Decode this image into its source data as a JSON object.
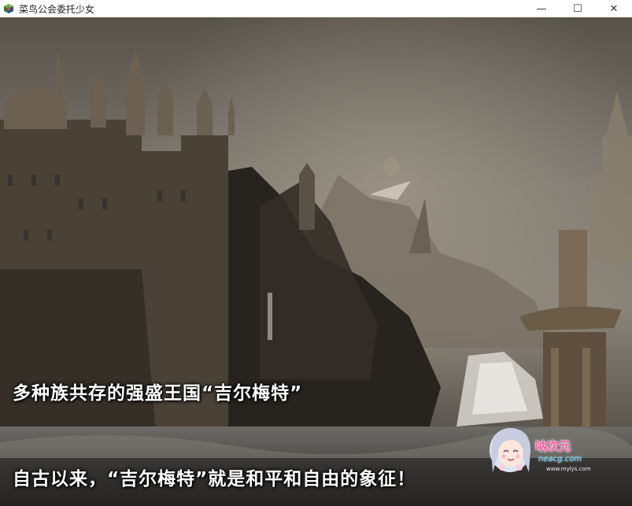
{
  "window": {
    "title": "菜鸟公会委托少女",
    "minimize_glyph": "—",
    "maximize_glyph": "☐",
    "close_glyph": "✕",
    "icon": "game-app-icon"
  },
  "scene": {
    "description_icon": "fantasy-castle-background",
    "captions": [
      "多种族共存的强盛王国“吉尔梅特”",
      "自古以来，“吉尔梅特”就是和平和自由的象征！"
    ]
  },
  "watermark": {
    "title": "呐次元",
    "line1": "neacg.com",
    "line2": "www.mylys.com"
  }
}
